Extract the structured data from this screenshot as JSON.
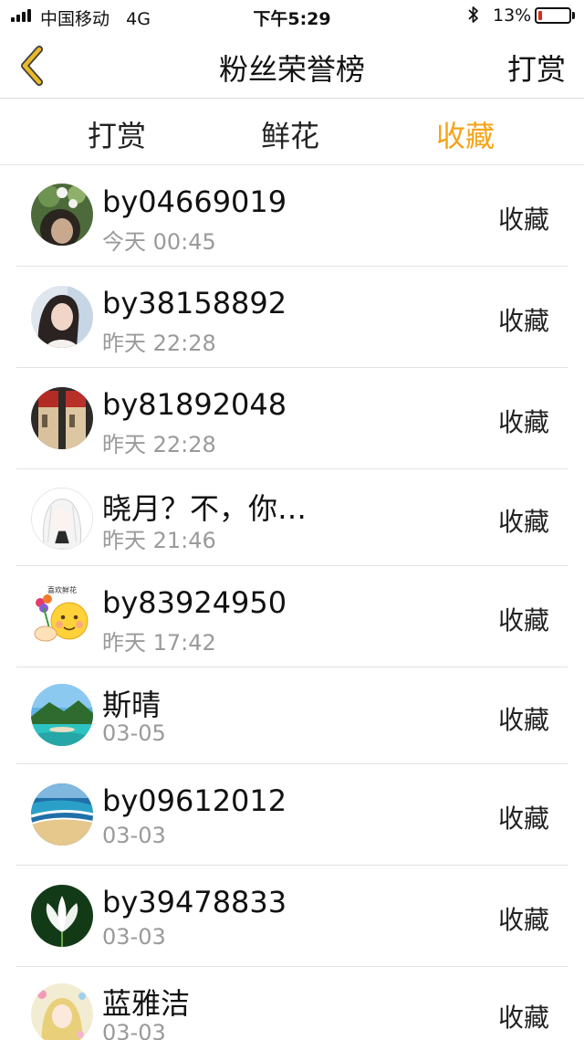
{
  "status_bar": {
    "carrier": "中国移动",
    "network": "4G",
    "time": "下午5:29",
    "battery_percent": "13%",
    "battery_level": 0.13
  },
  "nav": {
    "title": "粉丝荣誉榜",
    "right_label": "打赏",
    "back_icon": "chevron-left-icon"
  },
  "tabs": [
    {
      "label": "打赏",
      "active": false
    },
    {
      "label": "鲜花",
      "active": false
    },
    {
      "label": "收藏",
      "active": true
    }
  ],
  "colors": {
    "accent": "#f5a416",
    "battery_low": "#e0271c",
    "back_icon": "#e9b92a"
  },
  "fans": [
    {
      "name": "by04669019",
      "time": "今天 00:45",
      "action": "收藏",
      "avatar": "girl-with-flowers-avatar"
    },
    {
      "name": "by38158892",
      "time": "昨天 22:28",
      "action": "收藏",
      "avatar": "girl-portrait-avatar"
    },
    {
      "name": "by81892048",
      "time": "昨天 22:28",
      "action": "收藏",
      "avatar": "bottles-avatar"
    },
    {
      "name": "晓月？不，你…",
      "time": "昨天 21:46",
      "action": "收藏",
      "avatar": "anime-girl-avatar"
    },
    {
      "name": "by83924950",
      "time": "昨天 17:42",
      "action": "收藏",
      "avatar": "emoji-flowers-avatar",
      "avatar_caption": "喜欢鲜花"
    },
    {
      "name": "斯晴",
      "time": "03-05",
      "action": "收藏",
      "avatar": "tropical-beach-avatar"
    },
    {
      "name": "by09612012",
      "time": "03-03",
      "action": "收藏",
      "avatar": "coastline-avatar"
    },
    {
      "name": "by39478833",
      "time": "03-03",
      "action": "收藏",
      "avatar": "lotus-avatar"
    },
    {
      "name": "蓝雅洁",
      "time": "03-03",
      "action": "收藏",
      "avatar": "illustrated-girl-avatar"
    }
  ]
}
